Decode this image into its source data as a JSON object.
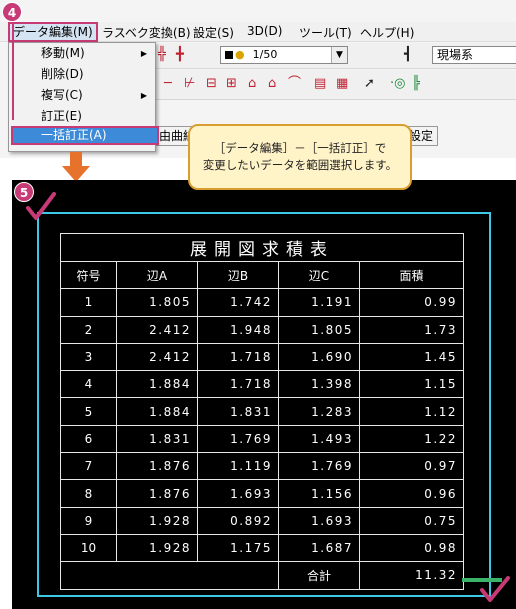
{
  "colors": {
    "accent": "#c73a75",
    "selection": "#3fc8e6",
    "callout_bg": "#fff3c8",
    "callout_border": "#d89e2f",
    "arrow": "#e6722c"
  },
  "steps": {
    "step4": "4",
    "step5": "5"
  },
  "menubar": {
    "items": [
      "データ編集(M)",
      "ラスベク変換(B)",
      "設定(S)",
      "3D(D)",
      "ツール(T)",
      "ヘルプ(H)"
    ]
  },
  "dropdown": {
    "items": [
      {
        "label": "移動(M)",
        "submenu": true
      },
      {
        "label": "削除(D)",
        "submenu": false
      },
      {
        "label": "複写(C)",
        "submenu": true
      },
      {
        "label": "訂正(E)",
        "submenu": false
      },
      {
        "label": "一括訂正(A)",
        "submenu": false
      }
    ]
  },
  "toolbar": {
    "scale_value": "1/50",
    "field_label": "現場系",
    "button1": "由曲線",
    "button2": "設定"
  },
  "callout": {
    "line1": "［データ編集］－［一括訂正］で",
    "line2": "変更したいデータを範囲選択します。"
  },
  "table": {
    "title": "展開図求積表",
    "headers": [
      "符号",
      "辺A",
      "辺B",
      "辺C",
      "面積"
    ],
    "rows": [
      [
        "1",
        "1.805",
        "1.742",
        "1.191",
        "0.99"
      ],
      [
        "2",
        "2.412",
        "1.948",
        "1.805",
        "1.73"
      ],
      [
        "3",
        "2.412",
        "1.718",
        "1.690",
        "1.45"
      ],
      [
        "4",
        "1.884",
        "1.718",
        "1.398",
        "1.15"
      ],
      [
        "5",
        "1.884",
        "1.831",
        "1.283",
        "1.12"
      ],
      [
        "6",
        "1.831",
        "1.769",
        "1.493",
        "1.22"
      ],
      [
        "7",
        "1.876",
        "1.119",
        "1.769",
        "0.97"
      ],
      [
        "8",
        "1.876",
        "1.693",
        "1.156",
        "0.96"
      ],
      [
        "9",
        "1.928",
        "0.892",
        "1.693",
        "0.75"
      ],
      [
        "10",
        "1.928",
        "1.175",
        "1.687",
        "0.98"
      ]
    ],
    "total_label": "合計",
    "total_value": "11.32"
  }
}
